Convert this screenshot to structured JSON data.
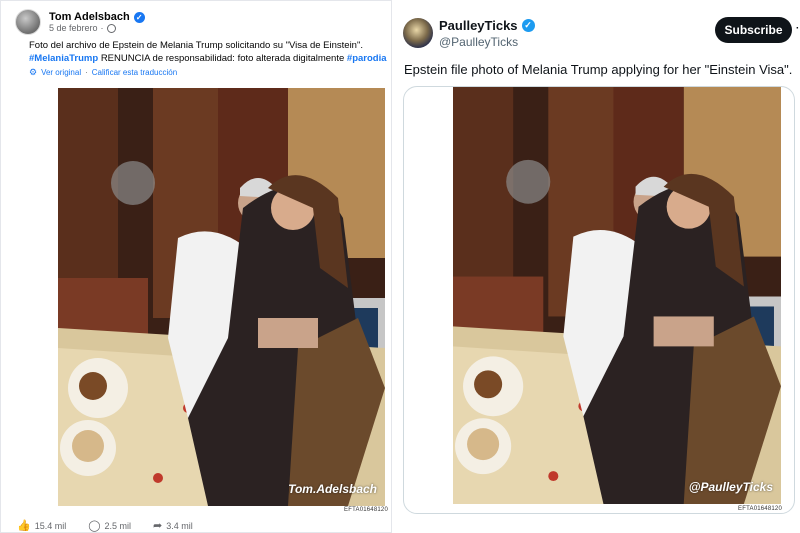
{
  "facebook_post": {
    "author": "Tom Adelsbach",
    "date": "5 de febrero",
    "date_separator": "·",
    "caption": "Foto del archivo de Epstein de Melania Trump solicitando su \"Visa de Einstein\".",
    "hashtag_1": "#MelaniaTrump",
    "disclaimer_text": "RENUNCIA de responsabilidad: foto alterada digitalmente",
    "hashtag_2": "#parodia",
    "see_original": "Ver original",
    "translate_separator": "·",
    "rate_translation": "Calificar esta traducción",
    "watermark": "Tom.Adelsbach",
    "file_id": "EFTA01648120",
    "reactions": {
      "likes": "15.4 mil",
      "comments": "2.5 mil",
      "shares": "3.4 mil"
    },
    "icons": {
      "verified": "verified-badge-icon",
      "like": "thumbs-up-icon",
      "comment": "comment-bubble-icon",
      "share": "share-arrow-icon",
      "globe": "globe-icon"
    }
  },
  "x_post": {
    "display_name": "PaulleyTicks",
    "handle": "@PaulleyTicks",
    "subscribe_label": "Subscribe",
    "more_label": "⋯",
    "text": "Epstein file photo of Melania Trump applying for her \"Einstein Visa\".",
    "watermark": "@PaulleyTicks",
    "file_id": "EFTA01648120"
  },
  "colors": {
    "facebook_blue": "#1877f2",
    "x_blue": "#1d9bf0",
    "x_button": "#0f1419",
    "muted_text": "#65676b",
    "x_muted": "#536471"
  }
}
